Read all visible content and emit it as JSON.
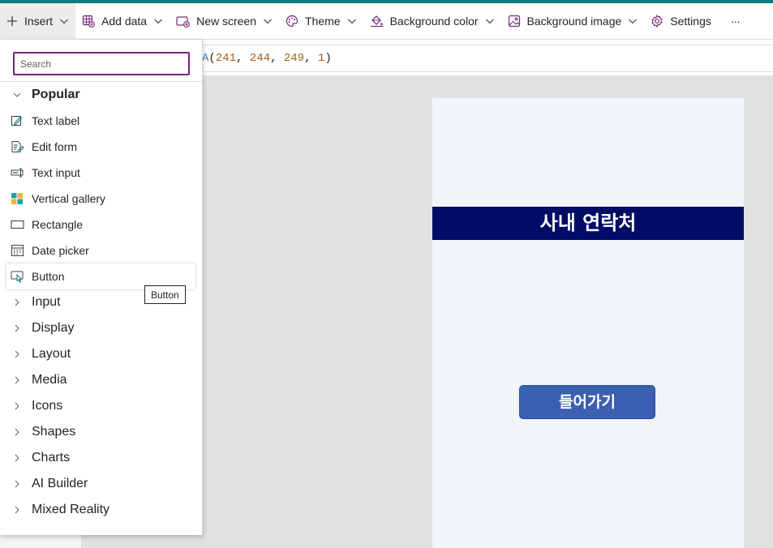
{
  "toolbar": {
    "insert": "Insert",
    "add_data": "Add data",
    "new_screen": "New screen",
    "theme": "Theme",
    "background_color": "Background color",
    "background_image": "Background image",
    "settings": "Settings",
    "more": "···"
  },
  "formula": {
    "fn_tail": "A",
    "open": "(",
    "r": "241",
    "g": "244",
    "b": "249",
    "a": "1",
    "sep": ", ",
    "close": ")"
  },
  "insert_panel": {
    "search_placeholder": "Search",
    "popular_label": "Popular",
    "popular_items": [
      {
        "label": "Text label",
        "icon": "text-label-icon"
      },
      {
        "label": "Edit form",
        "icon": "edit-form-icon"
      },
      {
        "label": "Text input",
        "icon": "text-input-icon"
      },
      {
        "label": "Vertical gallery",
        "icon": "gallery-icon"
      },
      {
        "label": "Rectangle",
        "icon": "rectangle-icon"
      },
      {
        "label": "Date picker",
        "icon": "calendar-icon"
      },
      {
        "label": "Button",
        "icon": "button-icon"
      }
    ],
    "groups": [
      "Input",
      "Display",
      "Layout",
      "Media",
      "Icons",
      "Shapes",
      "Charts",
      "AI Builder",
      "Mixed Reality"
    ],
    "tooltip": "Button"
  },
  "canvas": {
    "header_title": "사내 연락처",
    "enter_button": "들어가기",
    "header_color": "#000c66",
    "button_color": "#3b60b1",
    "screen_color": "#f1f4f9"
  }
}
